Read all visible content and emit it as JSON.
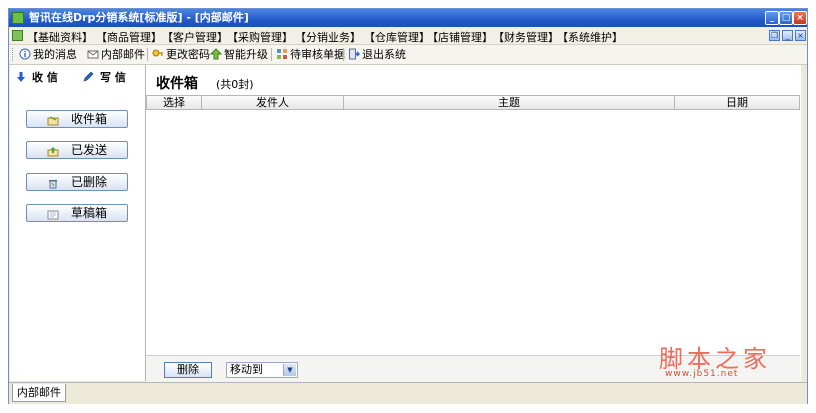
{
  "window": {
    "title": "智讯在线Drp分销系统[标准版] - [内部邮件]",
    "controls": {
      "minimize": "_",
      "maximize": "□",
      "close": "×"
    }
  },
  "menu": [
    "【基础资料】",
    "【商品管理】",
    "【客户管理】",
    "【采购管理】",
    "【分销业务】",
    "【仓库管理】",
    "【店铺管理】",
    "【财务管理】",
    "【系统维护】"
  ],
  "toolbar": {
    "my_messages": "我的消息",
    "internal_mail": "内部邮件",
    "change_password": "更改密码",
    "smart_upgrade": "智能升级",
    "pending_review": "待审核单据",
    "exit_system": "退出系统"
  },
  "sidebar": {
    "receive": "收 信",
    "compose": "写 信",
    "folders": {
      "inbox": "收件箱",
      "sent": "已发送",
      "deleted": "已删除",
      "drafts": "草稿箱"
    }
  },
  "main": {
    "title": "收件箱",
    "count": "(共0封)",
    "columns": {
      "select": "选择",
      "sender": "发件人",
      "subject": "主题",
      "date": "日期"
    },
    "delete_label": "删除",
    "move_to": "移动到"
  },
  "status": {
    "tab": "内部邮件"
  },
  "watermark": {
    "text": "脚本之家",
    "url": "www.jb51.net"
  },
  "colors": {
    "titlebar": "#2459c9",
    "watermark": "#ef6b5b",
    "accent_blue": "#1f5fd1"
  }
}
